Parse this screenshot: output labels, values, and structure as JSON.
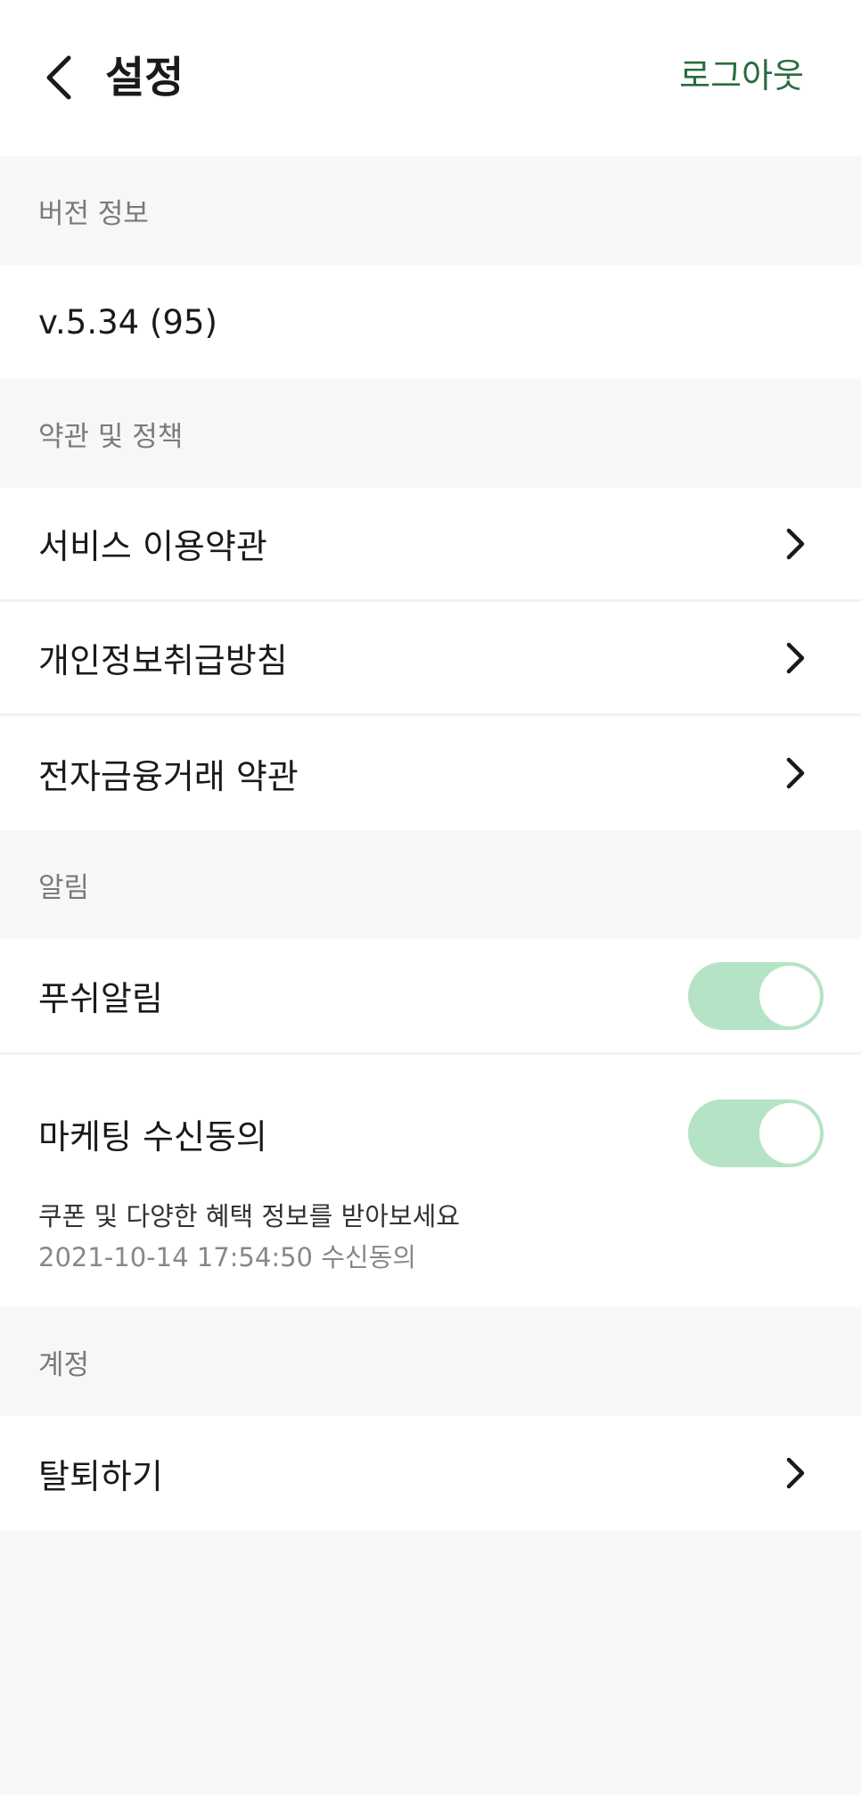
{
  "header": {
    "title": "설정",
    "logout_label": "로그아웃"
  },
  "sections": {
    "version": {
      "title": "버전 정보",
      "value": "v.5.34 (95)"
    },
    "terms": {
      "title": "약관 및 정책",
      "items": [
        {
          "label": "서비스 이용약관"
        },
        {
          "label": "개인정보취급방침"
        },
        {
          "label": "전자금융거래 약관"
        }
      ]
    },
    "notifications": {
      "title": "알림",
      "push": {
        "label": "푸쉬알림",
        "enabled": true
      },
      "marketing": {
        "label": "마케팅 수신동의",
        "enabled": true,
        "description": "쿠폰 및 다양한 혜택 정보를 받아보세요",
        "consent_date": "2021-10-14 17:54:50 수신동의"
      }
    },
    "account": {
      "title": "계정",
      "items": [
        {
          "label": "탈퇴하기"
        }
      ]
    }
  },
  "colors": {
    "accent": "#2b6b3f",
    "toggle_on": "#b5e3c6",
    "background": "#f7f7f7"
  },
  "icons": {
    "back": "chevron-left-icon",
    "row_chevron": "chevron-right-icon"
  }
}
